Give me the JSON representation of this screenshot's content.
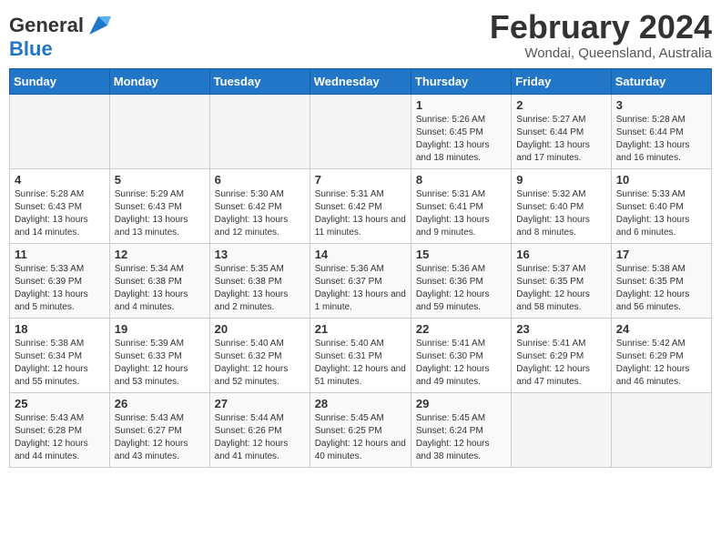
{
  "header": {
    "logo_general": "General",
    "logo_blue": "Blue",
    "month_title": "February 2024",
    "location": "Wondai, Queensland, Australia"
  },
  "days_of_week": [
    "Sunday",
    "Monday",
    "Tuesday",
    "Wednesday",
    "Thursday",
    "Friday",
    "Saturday"
  ],
  "weeks": [
    [
      {
        "day": "",
        "info": ""
      },
      {
        "day": "",
        "info": ""
      },
      {
        "day": "",
        "info": ""
      },
      {
        "day": "",
        "info": ""
      },
      {
        "day": "1",
        "info": "Sunrise: 5:26 AM\nSunset: 6:45 PM\nDaylight: 13 hours\nand 18 minutes."
      },
      {
        "day": "2",
        "info": "Sunrise: 5:27 AM\nSunset: 6:44 PM\nDaylight: 13 hours\nand 17 minutes."
      },
      {
        "day": "3",
        "info": "Sunrise: 5:28 AM\nSunset: 6:44 PM\nDaylight: 13 hours\nand 16 minutes."
      }
    ],
    [
      {
        "day": "4",
        "info": "Sunrise: 5:28 AM\nSunset: 6:43 PM\nDaylight: 13 hours\nand 14 minutes."
      },
      {
        "day": "5",
        "info": "Sunrise: 5:29 AM\nSunset: 6:43 PM\nDaylight: 13 hours\nand 13 minutes."
      },
      {
        "day": "6",
        "info": "Sunrise: 5:30 AM\nSunset: 6:42 PM\nDaylight: 13 hours\nand 12 minutes."
      },
      {
        "day": "7",
        "info": "Sunrise: 5:31 AM\nSunset: 6:42 PM\nDaylight: 13 hours\nand 11 minutes."
      },
      {
        "day": "8",
        "info": "Sunrise: 5:31 AM\nSunset: 6:41 PM\nDaylight: 13 hours\nand 9 minutes."
      },
      {
        "day": "9",
        "info": "Sunrise: 5:32 AM\nSunset: 6:40 PM\nDaylight: 13 hours\nand 8 minutes."
      },
      {
        "day": "10",
        "info": "Sunrise: 5:33 AM\nSunset: 6:40 PM\nDaylight: 13 hours\nand 6 minutes."
      }
    ],
    [
      {
        "day": "11",
        "info": "Sunrise: 5:33 AM\nSunset: 6:39 PM\nDaylight: 13 hours\nand 5 minutes."
      },
      {
        "day": "12",
        "info": "Sunrise: 5:34 AM\nSunset: 6:38 PM\nDaylight: 13 hours\nand 4 minutes."
      },
      {
        "day": "13",
        "info": "Sunrise: 5:35 AM\nSunset: 6:38 PM\nDaylight: 13 hours\nand 2 minutes."
      },
      {
        "day": "14",
        "info": "Sunrise: 5:36 AM\nSunset: 6:37 PM\nDaylight: 13 hours\nand 1 minute."
      },
      {
        "day": "15",
        "info": "Sunrise: 5:36 AM\nSunset: 6:36 PM\nDaylight: 12 hours\nand 59 minutes."
      },
      {
        "day": "16",
        "info": "Sunrise: 5:37 AM\nSunset: 6:35 PM\nDaylight: 12 hours\nand 58 minutes."
      },
      {
        "day": "17",
        "info": "Sunrise: 5:38 AM\nSunset: 6:35 PM\nDaylight: 12 hours\nand 56 minutes."
      }
    ],
    [
      {
        "day": "18",
        "info": "Sunrise: 5:38 AM\nSunset: 6:34 PM\nDaylight: 12 hours\nand 55 minutes."
      },
      {
        "day": "19",
        "info": "Sunrise: 5:39 AM\nSunset: 6:33 PM\nDaylight: 12 hours\nand 53 minutes."
      },
      {
        "day": "20",
        "info": "Sunrise: 5:40 AM\nSunset: 6:32 PM\nDaylight: 12 hours\nand 52 minutes."
      },
      {
        "day": "21",
        "info": "Sunrise: 5:40 AM\nSunset: 6:31 PM\nDaylight: 12 hours\nand 51 minutes."
      },
      {
        "day": "22",
        "info": "Sunrise: 5:41 AM\nSunset: 6:30 PM\nDaylight: 12 hours\nand 49 minutes."
      },
      {
        "day": "23",
        "info": "Sunrise: 5:41 AM\nSunset: 6:29 PM\nDaylight: 12 hours\nand 47 minutes."
      },
      {
        "day": "24",
        "info": "Sunrise: 5:42 AM\nSunset: 6:29 PM\nDaylight: 12 hours\nand 46 minutes."
      }
    ],
    [
      {
        "day": "25",
        "info": "Sunrise: 5:43 AM\nSunset: 6:28 PM\nDaylight: 12 hours\nand 44 minutes."
      },
      {
        "day": "26",
        "info": "Sunrise: 5:43 AM\nSunset: 6:27 PM\nDaylight: 12 hours\nand 43 minutes."
      },
      {
        "day": "27",
        "info": "Sunrise: 5:44 AM\nSunset: 6:26 PM\nDaylight: 12 hours\nand 41 minutes."
      },
      {
        "day": "28",
        "info": "Sunrise: 5:45 AM\nSunset: 6:25 PM\nDaylight: 12 hours\nand 40 minutes."
      },
      {
        "day": "29",
        "info": "Sunrise: 5:45 AM\nSunset: 6:24 PM\nDaylight: 12 hours\nand 38 minutes."
      },
      {
        "day": "",
        "info": ""
      },
      {
        "day": "",
        "info": ""
      }
    ]
  ]
}
